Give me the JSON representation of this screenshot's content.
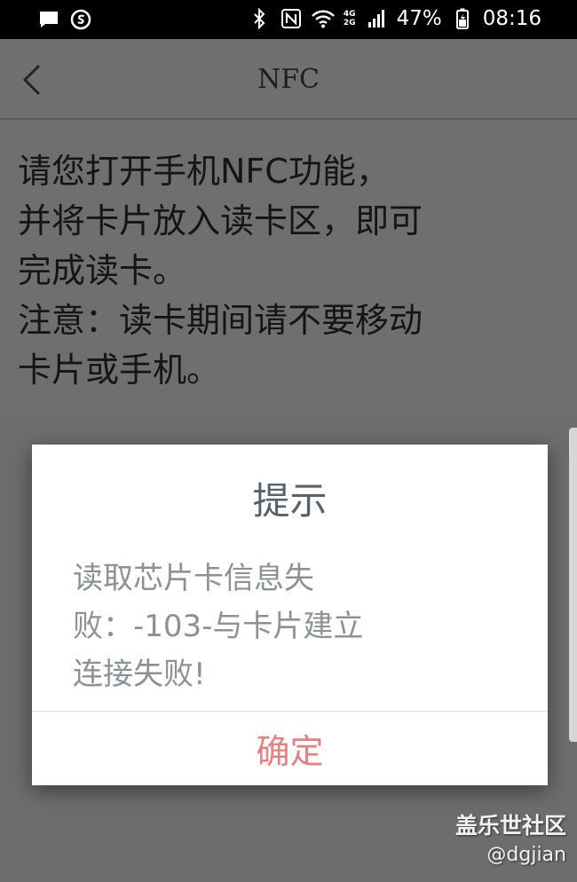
{
  "status_bar": {
    "battery": "47%",
    "time": "08:16",
    "network_top": "4G",
    "network_bottom": "2G",
    "icons": [
      "message-icon",
      "samsung-icon",
      "bluetooth-icon",
      "nfc-icon",
      "wifi-icon",
      "signal-icon",
      "battery-icon"
    ]
  },
  "header": {
    "back_icon": "chevron-left-icon",
    "title": "NFC"
  },
  "instructions": [
    "请您打开手机NFC功能，",
    "并将卡片放入读卡区，即可",
    "完成读卡。",
    "注意：读卡期间请不要移动",
    "卡片或手机。"
  ],
  "dialog": {
    "title": "提示",
    "message_lines": [
      "读取芯片卡信息失",
      "败：-103-与卡片建立",
      "连接失败!"
    ],
    "confirm_label": "确定"
  },
  "watermark": {
    "line1": "盖乐世社区",
    "line2": "@dgjian"
  },
  "colors": {
    "dim_background": "#6d6d6d",
    "dialog_title": "#5a6068",
    "dialog_message": "#8c9198",
    "confirm": "#e87f7f"
  }
}
